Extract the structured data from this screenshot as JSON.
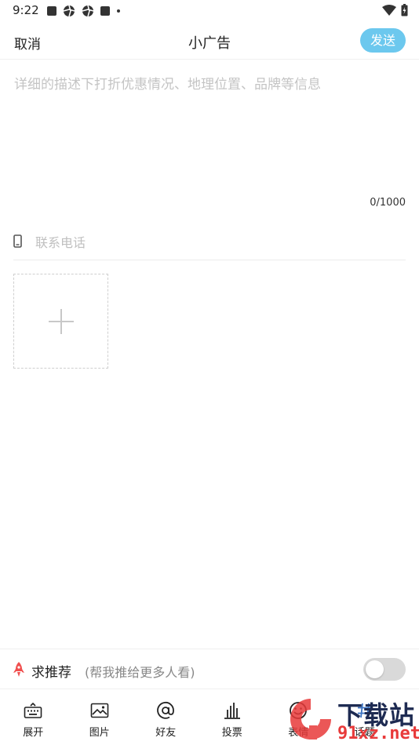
{
  "status_bar": {
    "time": "9:22"
  },
  "nav": {
    "cancel_label": "取消",
    "title": "小广告",
    "send_label": "发送"
  },
  "compose": {
    "description_placeholder": "详细的描述下打折优惠情况、地理位置、品牌等信息",
    "char_count": "0/1000",
    "phone_placeholder": "联系电话"
  },
  "recommend": {
    "label": "求推荐",
    "sublabel": "(帮我推给更多人看)",
    "enabled": false
  },
  "toolbar": {
    "items": [
      {
        "label": "展开",
        "icon": "keyboard-icon"
      },
      {
        "label": "图片",
        "icon": "image-icon"
      },
      {
        "label": "好友",
        "icon": "at-icon"
      },
      {
        "label": "投票",
        "icon": "vote-icon"
      },
      {
        "label": "表情",
        "icon": "emoji-icon"
      },
      {
        "label": "话题",
        "icon": "topic-icon"
      }
    ]
  },
  "watermark": {
    "line1": "下载站",
    "line2": "91xz.net"
  },
  "colors": {
    "accent": "#6cc8ee",
    "recommend_icon": "#f0504f",
    "watermark_red": "#e83a3a",
    "watermark_navy": "#1e2b52"
  }
}
